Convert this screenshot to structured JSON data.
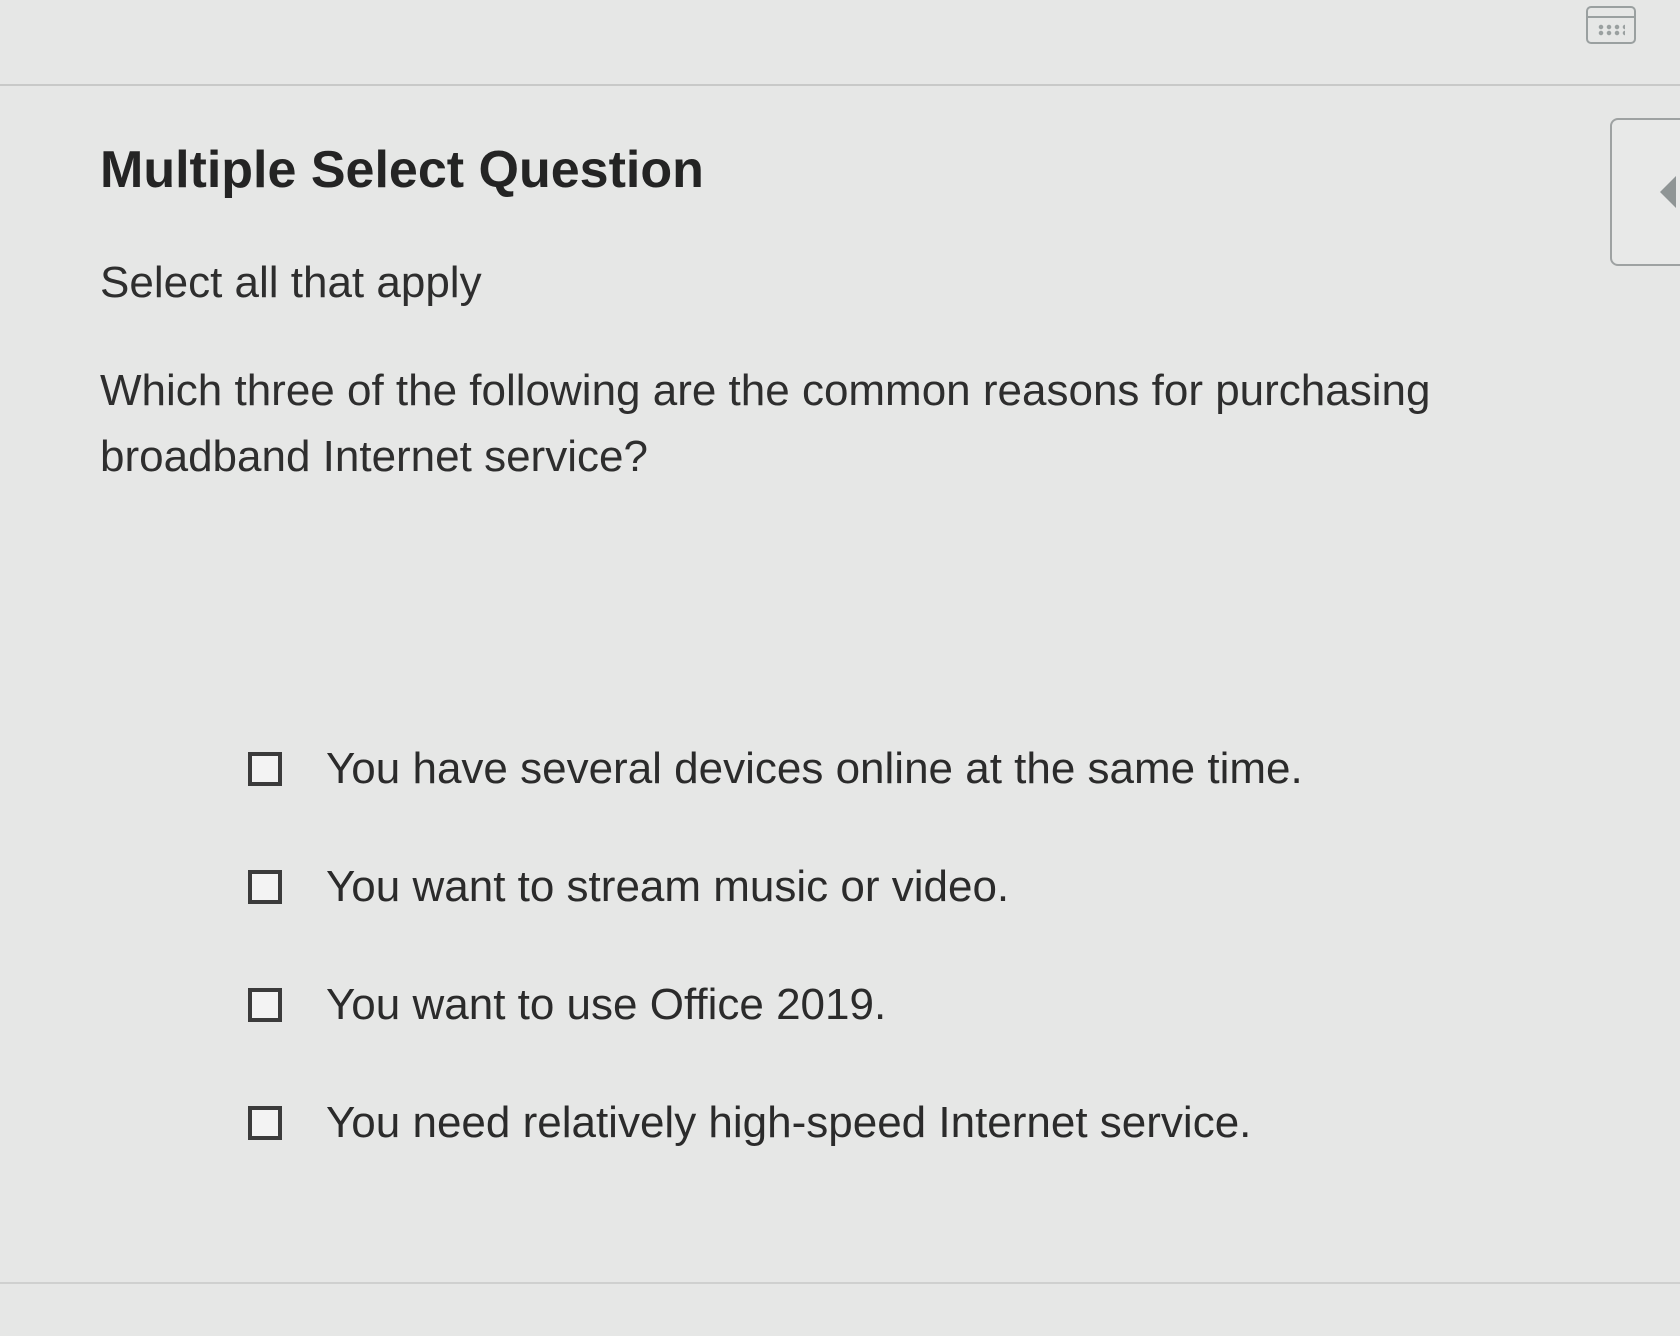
{
  "header": {
    "calendar_icon": "calendar-icon"
  },
  "question": {
    "title": "Multiple Select Question",
    "instruction": "Select all that apply",
    "text": "Which three of the following are the common reasons for purchasing broadband Internet service?"
  },
  "options": [
    {
      "label": "You have several devices online at the same time.",
      "checked": false
    },
    {
      "label": "You want to stream music or video.",
      "checked": false
    },
    {
      "label": "You want to use Office 2019.",
      "checked": false
    },
    {
      "label": "You need relatively high-speed Internet service.",
      "checked": false
    }
  ],
  "side_panel": {
    "icon": "arrow-left-icon"
  }
}
